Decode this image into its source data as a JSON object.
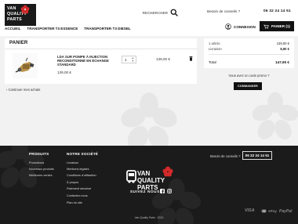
{
  "header": {
    "brand": {
      "line1": "VAN",
      "line2": "QUALITY",
      "line3": "PARTS"
    },
    "search": {
      "placeholder": "RECHERCHER"
    },
    "help_text": "Besoin de conseils ?",
    "phone": "06 32 24 14 51",
    "nav": [
      "ACCUEIL",
      "TRANSPORTER T3 ESSENCE",
      "TRANSPORTER T3 DIESEL"
    ],
    "connexion_label": "CONNEXION",
    "cart_button_label": "PANIER (1)"
  },
  "cart": {
    "title": "PANIER",
    "item": {
      "name": "LDA SUR POMPE À INJECTION RECONDITIONNÉ EN ÉCHANGE STANDARD",
      "unit_price": "139,00 €",
      "quantity": "1",
      "total": "139,00 €"
    },
    "continue_link": "Continuer mes achats"
  },
  "summary": {
    "articles_label": "1 article",
    "articles_value": "139,00 €",
    "shipping_label": "Livraison",
    "shipping_value": "8,90 €",
    "total_label": "Total",
    "total_value": "147,90 €",
    "promo_link": "Vous avez un code promo ?",
    "order_button": "COMMANDER"
  },
  "footer": {
    "products": {
      "title": "PRODUITS",
      "items": [
        "Promotions",
        "Nouveaux produits",
        "Meilleures ventes"
      ]
    },
    "company": {
      "title": "NOTRE SOCIÉTÉ",
      "items": [
        "Livraison",
        "Mentions légales",
        "Conditions d'utilisation",
        "À propos",
        "Paiement sécurisé",
        "Contactez-nous",
        "Plan du site"
      ]
    },
    "help_text": "Besoin de conseils ?",
    "phone": "06 32 24 14 51",
    "follow_label": "SUIVEZ NOUS",
    "copyright": "Van Quality Parts · 2021",
    "payments": [
      "VISA",
      "Pay",
      "PayPal"
    ]
  },
  "colors": {
    "accent": "#d32a2a",
    "dark": "#1b1b1b",
    "panel": "#f2f2f2"
  }
}
